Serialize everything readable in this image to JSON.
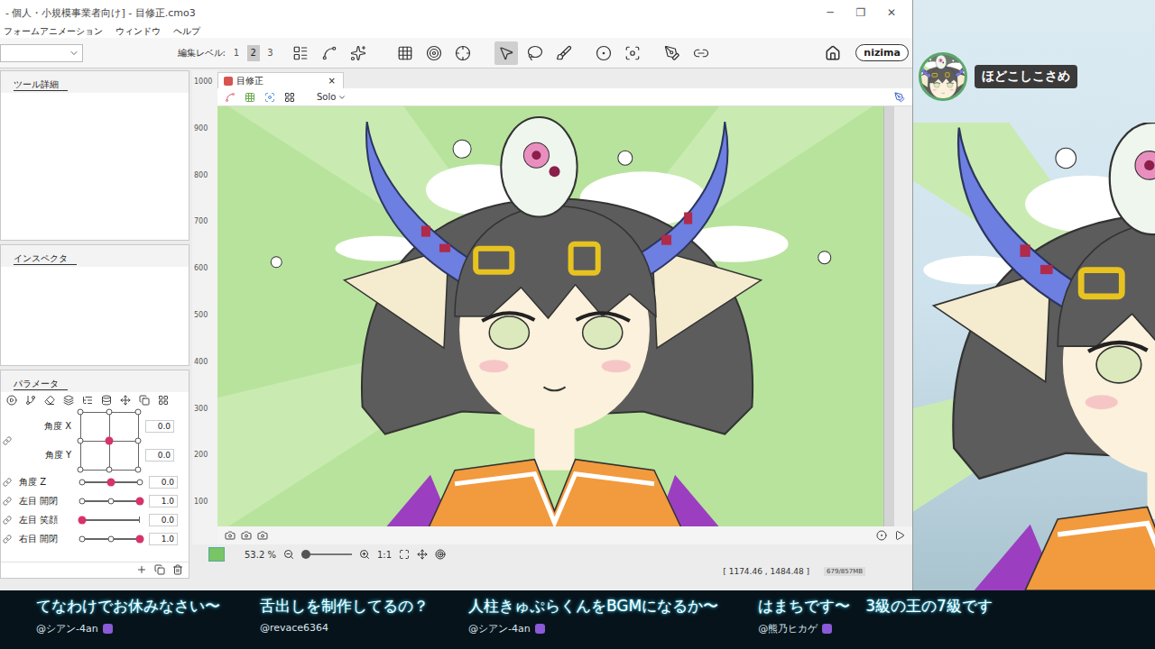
{
  "window": {
    "title": "- 個人・小規模事業者向け] - 目修正.cmo3",
    "controls": [
      "─",
      "❐",
      "✕"
    ]
  },
  "menu": [
    "フォームアニメーション",
    "ウィンドウ",
    "ヘルプ"
  ],
  "toolbar": {
    "edit_level_label": "編集レベル:",
    "levels": [
      {
        "label": "1",
        "selected": false
      },
      {
        "label": "2",
        "selected": true
      },
      {
        "label": "3",
        "selected": false
      }
    ],
    "tools": [
      {
        "selected": false
      },
      {
        "selected": false
      },
      {
        "selected": false
      },
      {
        "selected": false
      },
      {
        "selected": false
      },
      {
        "selected": false
      },
      {
        "selected": true
      },
      {
        "selected": false
      },
      {
        "selected": false
      },
      {
        "selected": false
      },
      {
        "selected": false
      },
      {
        "selected": false
      },
      {
        "selected": false
      }
    ],
    "brand": "nizima"
  },
  "left_panels": [
    {
      "title": "ツール詳細"
    },
    {
      "title": "インスペクタ"
    }
  ],
  "parameters": {
    "title": "パラメータ",
    "pad": {
      "labels": [
        "角度 X",
        "角度 Y"
      ],
      "values": [
        "0.0",
        "0.0"
      ],
      "x": 0.5,
      "y": 0.5
    },
    "sliders": [
      {
        "name": "角度 Z",
        "value": "0.0",
        "level": 0.5,
        "kind": "three-point"
      },
      {
        "name": "左目 開閉",
        "value": "1.0",
        "level": 1,
        "kind": "three-point"
      },
      {
        "name": "左目 笑顔",
        "value": "0.0",
        "level": 0,
        "kind": "two-point"
      },
      {
        "name": "右目 開閉",
        "value": "1.0",
        "level": 1,
        "kind": "three-point"
      }
    ]
  },
  "document": {
    "tab": "目修正",
    "close": "×",
    "solo": "Solo",
    "ruler": [
      "1000",
      "900",
      "800",
      "700",
      "600",
      "500",
      "400",
      "300",
      "200",
      "100"
    ],
    "zoom": "53.2",
    "zoom_unit": "%",
    "ratio": "1:1",
    "coords": "[ 1174.46 , 1484.48 ]",
    "memory": "679/857MB"
  },
  "stream": {
    "name": "ほどこしこさめ"
  },
  "chat": [
    {
      "text": "てなわけでお休みなさい〜",
      "author": "@シアン-4an",
      "badge": true
    },
    {
      "text": "舌出しを制作してるの？",
      "author": "@revace6364",
      "badge": false
    },
    {
      "text": "人柱きゅぷらくんをBGMになるか〜",
      "author": "@シアン-4an",
      "badge": true
    },
    {
      "text": "はまちです〜　3級の王の7級です",
      "author": "@熊乃ヒカゲ",
      "badge": true
    }
  ]
}
